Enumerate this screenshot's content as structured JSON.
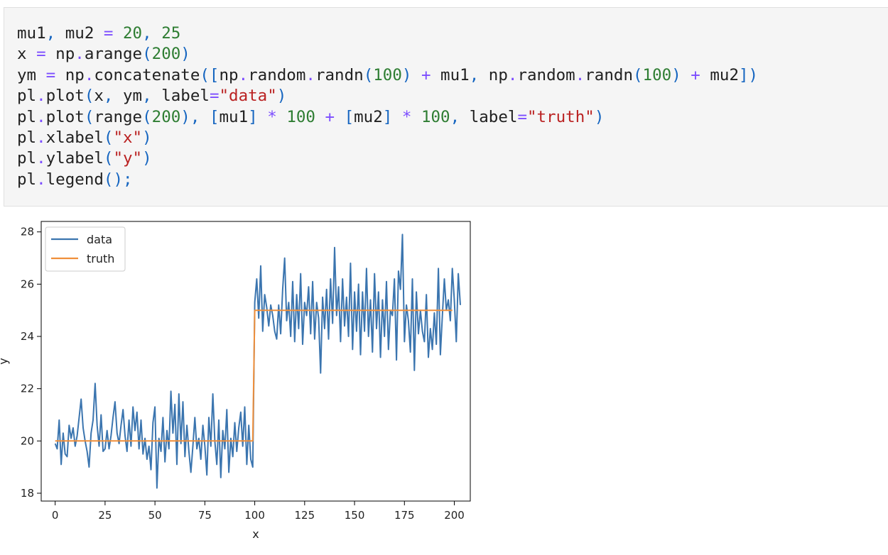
{
  "code_cell": {
    "lines": [
      [
        {
          "t": "mu1"
        },
        {
          "t": ",",
          "c": "pun"
        },
        {
          "t": " mu2 "
        },
        {
          "t": "=",
          "c": "kw-op"
        },
        {
          "t": " "
        },
        {
          "t": "20",
          "c": "num"
        },
        {
          "t": ",",
          "c": "pun"
        },
        {
          "t": " "
        },
        {
          "t": "25",
          "c": "num"
        }
      ],
      [
        {
          "t": "x "
        },
        {
          "t": "=",
          "c": "kw-op"
        },
        {
          "t": " np"
        },
        {
          "t": ".",
          "c": "kw-op"
        },
        {
          "t": "arange"
        },
        {
          "t": "(",
          "c": "pun"
        },
        {
          "t": "200",
          "c": "num"
        },
        {
          "t": ")",
          "c": "pun"
        }
      ],
      [
        {
          "t": "ym "
        },
        {
          "t": "=",
          "c": "kw-op"
        },
        {
          "t": " np"
        },
        {
          "t": ".",
          "c": "kw-op"
        },
        {
          "t": "concatenate"
        },
        {
          "t": "([",
          "c": "pun"
        },
        {
          "t": "np"
        },
        {
          "t": ".",
          "c": "kw-op"
        },
        {
          "t": "random"
        },
        {
          "t": ".",
          "c": "kw-op"
        },
        {
          "t": "randn"
        },
        {
          "t": "(",
          "c": "pun"
        },
        {
          "t": "100",
          "c": "num"
        },
        {
          "t": ")",
          "c": "pun"
        },
        {
          "t": " "
        },
        {
          "t": "+",
          "c": "kw-op"
        },
        {
          "t": " mu1"
        },
        {
          "t": ",",
          "c": "pun"
        },
        {
          "t": " np"
        },
        {
          "t": ".",
          "c": "kw-op"
        },
        {
          "t": "random"
        },
        {
          "t": ".",
          "c": "kw-op"
        },
        {
          "t": "randn"
        },
        {
          "t": "(",
          "c": "pun"
        },
        {
          "t": "100",
          "c": "num"
        },
        {
          "t": ")",
          "c": "pun"
        },
        {
          "t": " "
        },
        {
          "t": "+",
          "c": "kw-op"
        },
        {
          "t": " mu2"
        },
        {
          "t": "])",
          "c": "pun"
        }
      ],
      [
        {
          "t": "pl"
        },
        {
          "t": ".",
          "c": "kw-op"
        },
        {
          "t": "plot"
        },
        {
          "t": "(",
          "c": "pun"
        },
        {
          "t": "x"
        },
        {
          "t": ",",
          "c": "pun"
        },
        {
          "t": " ym"
        },
        {
          "t": ",",
          "c": "pun"
        },
        {
          "t": " label"
        },
        {
          "t": "=",
          "c": "kw-op"
        },
        {
          "t": "\"data\"",
          "c": "str"
        },
        {
          "t": ")",
          "c": "pun"
        }
      ],
      [
        {
          "t": "pl"
        },
        {
          "t": ".",
          "c": "kw-op"
        },
        {
          "t": "plot"
        },
        {
          "t": "(",
          "c": "pun"
        },
        {
          "t": "range"
        },
        {
          "t": "(",
          "c": "pun"
        },
        {
          "t": "200",
          "c": "num"
        },
        {
          "t": "),",
          "c": "pun"
        },
        {
          "t": " "
        },
        {
          "t": "[",
          "c": "pun"
        },
        {
          "t": "mu1"
        },
        {
          "t": "]",
          "c": "pun"
        },
        {
          "t": " "
        },
        {
          "t": "*",
          "c": "kw-op"
        },
        {
          "t": " "
        },
        {
          "t": "100",
          "c": "num"
        },
        {
          "t": " "
        },
        {
          "t": "+",
          "c": "kw-op"
        },
        {
          "t": " "
        },
        {
          "t": "[",
          "c": "pun"
        },
        {
          "t": "mu2"
        },
        {
          "t": "]",
          "c": "pun"
        },
        {
          "t": " "
        },
        {
          "t": "*",
          "c": "kw-op"
        },
        {
          "t": " "
        },
        {
          "t": "100",
          "c": "num"
        },
        {
          "t": ",",
          "c": "pun"
        },
        {
          "t": " label"
        },
        {
          "t": "=",
          "c": "kw-op"
        },
        {
          "t": "\"truth\"",
          "c": "str"
        },
        {
          "t": ")",
          "c": "pun"
        }
      ],
      [
        {
          "t": "pl"
        },
        {
          "t": ".",
          "c": "kw-op"
        },
        {
          "t": "xlabel"
        },
        {
          "t": "(",
          "c": "pun"
        },
        {
          "t": "\"x\"",
          "c": "str"
        },
        {
          "t": ")",
          "c": "pun"
        }
      ],
      [
        {
          "t": "pl"
        },
        {
          "t": ".",
          "c": "kw-op"
        },
        {
          "t": "ylabel"
        },
        {
          "t": "(",
          "c": "pun"
        },
        {
          "t": "\"y\"",
          "c": "str"
        },
        {
          "t": ")",
          "c": "pun"
        }
      ],
      [
        {
          "t": "pl"
        },
        {
          "t": ".",
          "c": "kw-op"
        },
        {
          "t": "legend"
        },
        {
          "t": "();",
          "c": "pun"
        }
      ]
    ]
  },
  "chart_data": {
    "type": "line",
    "xlabel": "x",
    "ylabel": "y",
    "xlim": [
      -7,
      208
    ],
    "ylim": [
      17.7,
      28.4
    ],
    "xticks": [
      0,
      25,
      50,
      75,
      100,
      125,
      150,
      175,
      200
    ],
    "yticks": [
      18,
      20,
      22,
      24,
      26,
      28
    ],
    "legend_position": "top-left",
    "grid": false,
    "series": [
      {
        "name": "data",
        "color": "#3b75af",
        "x_start": 0,
        "y": [
          19.9,
          19.7,
          20.8,
          19.1,
          20.3,
          19.5,
          19.4,
          20.6,
          20.1,
          20.5,
          19.8,
          20.2,
          20.9,
          21.6,
          20.5,
          20.0,
          19.6,
          19.0,
          20.3,
          20.8,
          22.2,
          20.6,
          19.8,
          21.0,
          19.6,
          19.7,
          20.4,
          19.7,
          20.2,
          20.9,
          21.5,
          20.3,
          19.9,
          20.6,
          21.2,
          20.2,
          19.6,
          20.8,
          19.8,
          21.3,
          20.4,
          21.1,
          19.7,
          20.8,
          19.5,
          20.1,
          19.3,
          19.8,
          18.9,
          20.7,
          21.3,
          18.2,
          20.1,
          19.6,
          20.9,
          19.2,
          20.4,
          19.7,
          21.9,
          20.3,
          21.4,
          19.1,
          21.8,
          19.9,
          21.5,
          19.4,
          20.6,
          19.6,
          18.8,
          19.8,
          20.9,
          19.7,
          20.1,
          19.3,
          20.6,
          19.8,
          18.7,
          20.9,
          19.8,
          21.8,
          20.0,
          19.1,
          20.8,
          18.6,
          20.4,
          19.7,
          21.2,
          18.8,
          20.1,
          19.4,
          20.7,
          19.6,
          20.5,
          21.1,
          19.8,
          21.3,
          19.1,
          20.6,
          19.3,
          19.0,
          25.3,
          26.2,
          24.7,
          26.7,
          24.2,
          25.6,
          25.1,
          24.4,
          25.2,
          24.8,
          24.2,
          23.9,
          25.2,
          24.1,
          25.8,
          27.0,
          24.6,
          25.3,
          24.0,
          26.1,
          23.8,
          25.6,
          24.3,
          26.4,
          23.7,
          25.3,
          24.8,
          25.9,
          24.1,
          26.1,
          23.9,
          25.3,
          24.7,
          22.6,
          25.5,
          24.3,
          25.8,
          23.9,
          26.2,
          24.5,
          27.4,
          24.8,
          25.9,
          23.8,
          26.2,
          24.4,
          25.5,
          24.0,
          26.8,
          23.5,
          25.7,
          24.2,
          26.0,
          23.3,
          25.7,
          24.2,
          26.6,
          24.0,
          25.4,
          23.4,
          26.4,
          24.3,
          25.7,
          23.2,
          25.4,
          24.0,
          26.1,
          23.5,
          25.0,
          24.8,
          26.2,
          23.1,
          26.5,
          25.8,
          27.9,
          23.8,
          25.2,
          24.6,
          23.4,
          26.2,
          22.7,
          25.7,
          24.1,
          25.0,
          24.2,
          23.8,
          25.6,
          23.2,
          24.3,
          23.5,
          24.9,
          23.7,
          26.6,
          23.3,
          24.8,
          26.2,
          25.0,
          25.4,
          24.6,
          26.6,
          25.4,
          23.8,
          26.4,
          25.2
        ]
      },
      {
        "name": "truth",
        "color": "#f08f3a",
        "x": [
          0,
          99,
          100,
          199
        ],
        "y": [
          20,
          20,
          25,
          25
        ]
      }
    ]
  }
}
